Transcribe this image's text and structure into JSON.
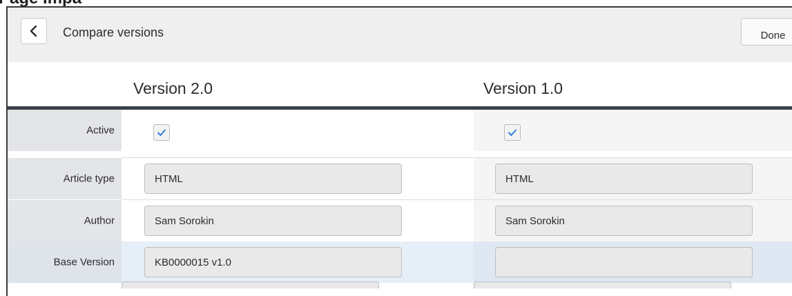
{
  "page": {
    "clipped_heading": "Page Impa"
  },
  "header": {
    "title": "Compare versions",
    "done_label": "Done"
  },
  "columns": {
    "left_heading": "Version 2.0",
    "right_heading": "Version 1.0"
  },
  "rows": [
    {
      "label": "Active",
      "type": "checkbox",
      "left": true,
      "right": true
    },
    {
      "label": "Article type",
      "type": "text",
      "left": "HTML",
      "right": "HTML"
    },
    {
      "label": "Author",
      "type": "text",
      "left": "Sam Sorokin",
      "right": "Sam Sorokin"
    },
    {
      "label": "Base Version",
      "type": "text",
      "left": "KB0000015 v1.0",
      "right": "",
      "changed": true
    }
  ],
  "colors": {
    "accent_check": "#2a7de1",
    "header_bg": "#efefef",
    "rule": "#3b4148",
    "changed_row": "#e6eef8"
  },
  "icons": {
    "back": "chevron-left-icon",
    "check": "checkmark-icon"
  }
}
